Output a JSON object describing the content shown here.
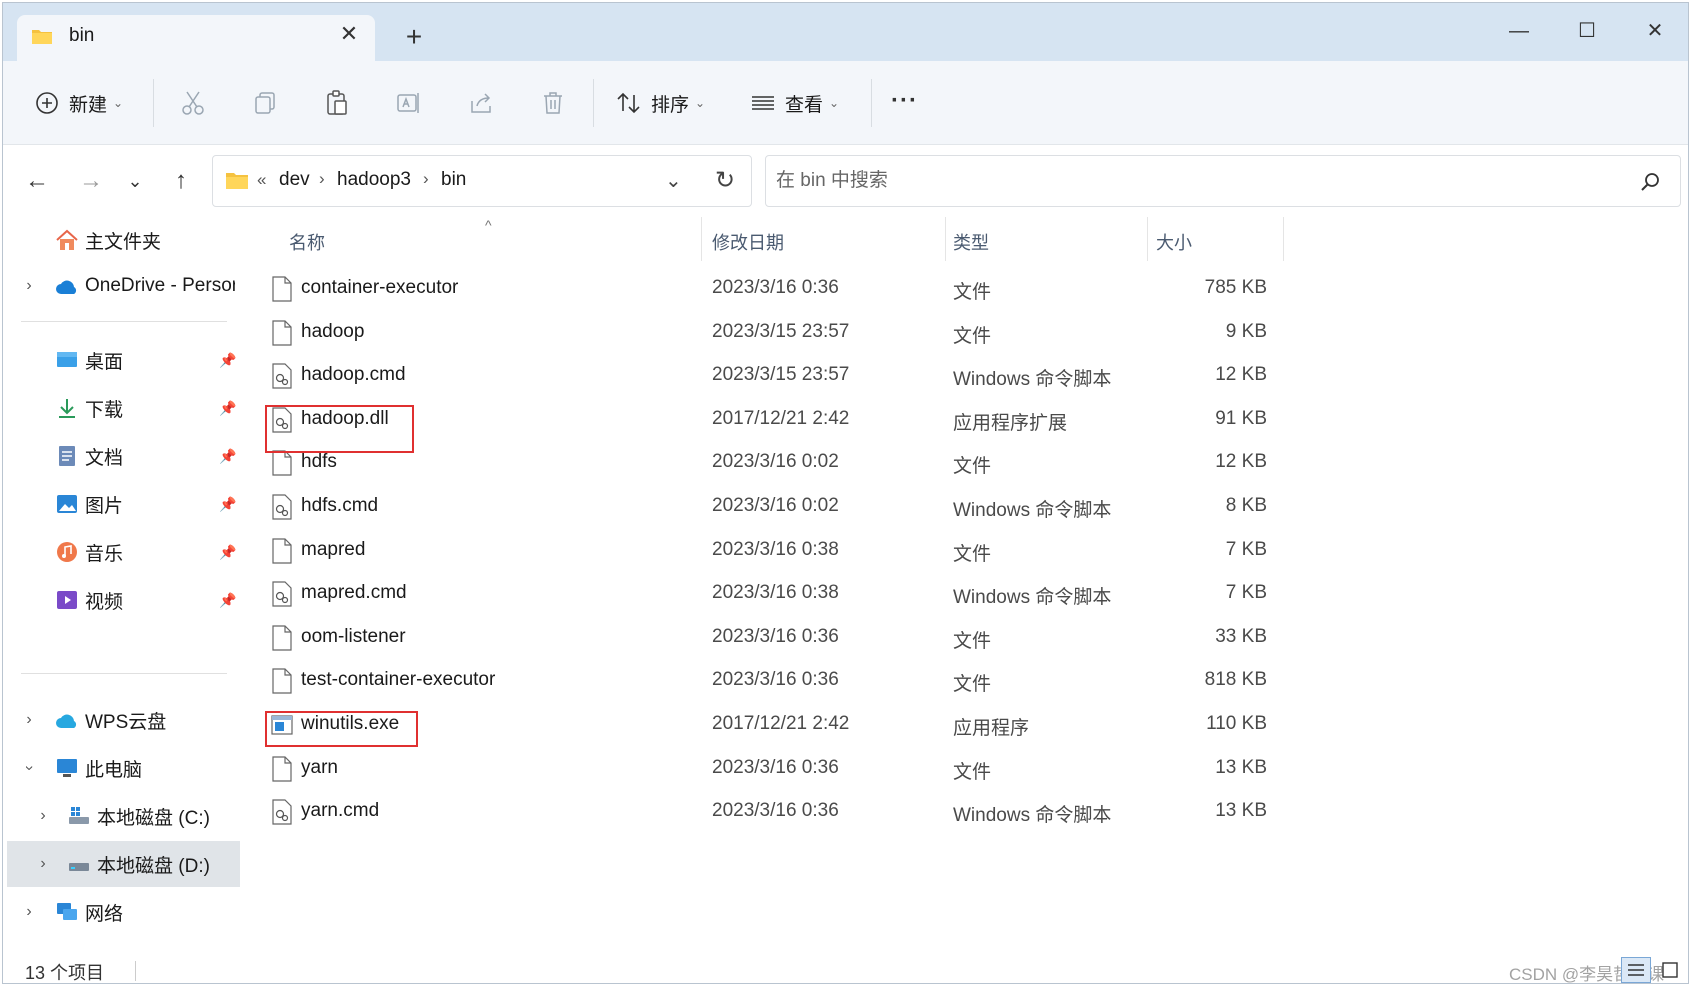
{
  "titlebar": {
    "tab_title": "bin",
    "tab_close": "✕",
    "new_tab": "+",
    "minimize": "—",
    "maximize": "☐",
    "close": "✕"
  },
  "toolbar": {
    "new_label": "新建",
    "sort_label": "排序",
    "view_label": "查看",
    "more": "···"
  },
  "address": {
    "overflow": "«",
    "crumbs": [
      "dev",
      "hadoop3",
      "bin"
    ],
    "search_placeholder": "在 bin 中搜索"
  },
  "sidebar": {
    "home": "主文件夹",
    "onedrive": "OneDrive - Persor",
    "quick": [
      {
        "label": "桌面",
        "icon": "desktop-icon"
      },
      {
        "label": "下载",
        "icon": "download-icon"
      },
      {
        "label": "文档",
        "icon": "documents-icon"
      },
      {
        "label": "图片",
        "icon": "pictures-icon"
      },
      {
        "label": "音乐",
        "icon": "music-icon"
      },
      {
        "label": "视频",
        "icon": "videos-icon"
      }
    ],
    "wps": "WPS云盘",
    "this_pc": "此电脑",
    "drive_c": "本地磁盘 (C:)",
    "drive_d": "本地磁盘 (D:)",
    "network": "网络"
  },
  "columns": {
    "name": "名称",
    "date": "修改日期",
    "type": "类型",
    "size": "大小"
  },
  "files": [
    {
      "name": "container-executor",
      "date": "2023/3/16 0:36",
      "type": "文件",
      "size": "785 KB",
      "icon": "file-icon"
    },
    {
      "name": "hadoop",
      "date": "2023/3/15 23:57",
      "type": "文件",
      "size": "9 KB",
      "icon": "file-icon"
    },
    {
      "name": "hadoop.cmd",
      "date": "2023/3/15 23:57",
      "type": "Windows 命令脚本",
      "size": "12 KB",
      "icon": "cmd-file-icon"
    },
    {
      "name": "hadoop.dll",
      "date": "2017/12/21 2:42",
      "type": "应用程序扩展",
      "size": "91 KB",
      "icon": "dll-file-icon"
    },
    {
      "name": "hdfs",
      "date": "2023/3/16 0:02",
      "type": "文件",
      "size": "12 KB",
      "icon": "file-icon"
    },
    {
      "name": "hdfs.cmd",
      "date": "2023/3/16 0:02",
      "type": "Windows 命令脚本",
      "size": "8 KB",
      "icon": "cmd-file-icon"
    },
    {
      "name": "mapred",
      "date": "2023/3/16 0:38",
      "type": "文件",
      "size": "7 KB",
      "icon": "file-icon"
    },
    {
      "name": "mapred.cmd",
      "date": "2023/3/16 0:38",
      "type": "Windows 命令脚本",
      "size": "7 KB",
      "icon": "cmd-file-icon"
    },
    {
      "name": "oom-listener",
      "date": "2023/3/16 0:36",
      "type": "文件",
      "size": "33 KB",
      "icon": "file-icon"
    },
    {
      "name": "test-container-executor",
      "date": "2023/3/16 0:36",
      "type": "文件",
      "size": "818 KB",
      "icon": "file-icon"
    },
    {
      "name": "winutils.exe",
      "date": "2017/12/21 2:42",
      "type": "应用程序",
      "size": "110 KB",
      "icon": "exe-file-icon"
    },
    {
      "name": "yarn",
      "date": "2023/3/16 0:36",
      "type": "文件",
      "size": "13 KB",
      "icon": "file-icon"
    },
    {
      "name": "yarn.cmd",
      "date": "2023/3/16 0:36",
      "type": "Windows 命令脚本",
      "size": "13 KB",
      "icon": "cmd-file-icon"
    }
  ],
  "status": {
    "count": "13 个项目",
    "watermark": "CSDN @李昊哲小课"
  },
  "colors": {
    "highlight": "#e03030",
    "accent": "#0067c0"
  }
}
